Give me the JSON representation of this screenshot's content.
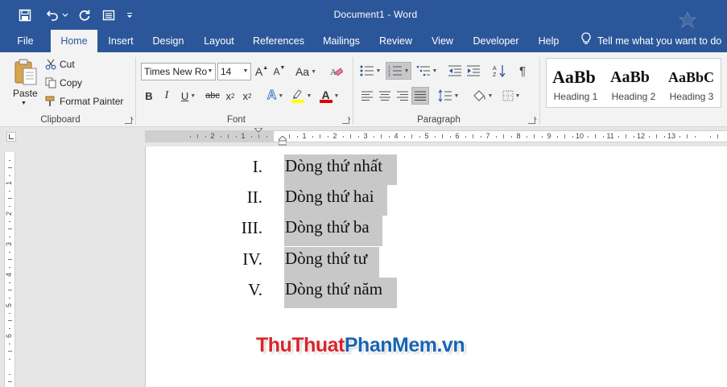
{
  "window": {
    "title": "Document1  -  Word"
  },
  "tabs": [
    "File",
    "Home",
    "Insert",
    "Design",
    "Layout",
    "References",
    "Mailings",
    "Review",
    "View",
    "Developer",
    "Help"
  ],
  "tell_me": "Tell me what you want to do",
  "clipboard": {
    "paste_label": "Paste",
    "cut_label": "Cut",
    "copy_label": "Copy",
    "format_painter_label": "Format Painter",
    "group_label": "Clipboard"
  },
  "font": {
    "font_name": "Times New Ro",
    "font_size": "14",
    "bold": "B",
    "italic": "I",
    "underline": "U",
    "strikethrough": "abc",
    "subscript": "x",
    "subscript_sub": "2",
    "superscript": "x",
    "superscript_sup": "2",
    "grow": "A",
    "shrink": "A",
    "change_case": "Aa",
    "text_effects": "A",
    "font_color_letter": "A",
    "group_label": "Font",
    "highlight_color": "#ffff00",
    "font_color": "#e00000"
  },
  "paragraph": {
    "group_label": "Paragraph",
    "pilcrow": "¶"
  },
  "styles": [
    {
      "sample": "AaBb",
      "name": "Heading 1"
    },
    {
      "sample": "AaBb",
      "name": "Heading 2"
    },
    {
      "sample": "AaBbC",
      "name": "Heading 3"
    }
  ],
  "ruler": {
    "left_numbers": [
      "2",
      "1"
    ],
    "right_numbers": [
      "1",
      "2",
      "3",
      "4",
      "5",
      "6",
      "7",
      "8",
      "9",
      "10",
      "11",
      "12",
      "13"
    ],
    "vertical_numbers": [
      "1",
      "2",
      "3",
      "4",
      "5",
      "6"
    ]
  },
  "document": {
    "list_items": [
      {
        "number": "I.",
        "text": "Dòng thứ nhất"
      },
      {
        "number": "II.",
        "text": "Dòng thứ hai"
      },
      {
        "number": "III.",
        "text": "Dòng thứ ba"
      },
      {
        "number": "IV.",
        "text": "Dòng thứ tư"
      },
      {
        "number": "V.",
        "text": "Dòng thứ năm"
      }
    ]
  },
  "watermark": {
    "part1": "Thu",
    "part2": "Thuat",
    "part3": "PhanMem",
    "part4": ".vn",
    "color1": "#d8252b",
    "color2": "#d8252b",
    "color3": "#1a64b0",
    "color4": "#1a64b0"
  },
  "colors": {
    "titlebar": "#2b579a",
    "ribbon_bg": "#f3f3f3",
    "selection": "#c8c8c8"
  }
}
